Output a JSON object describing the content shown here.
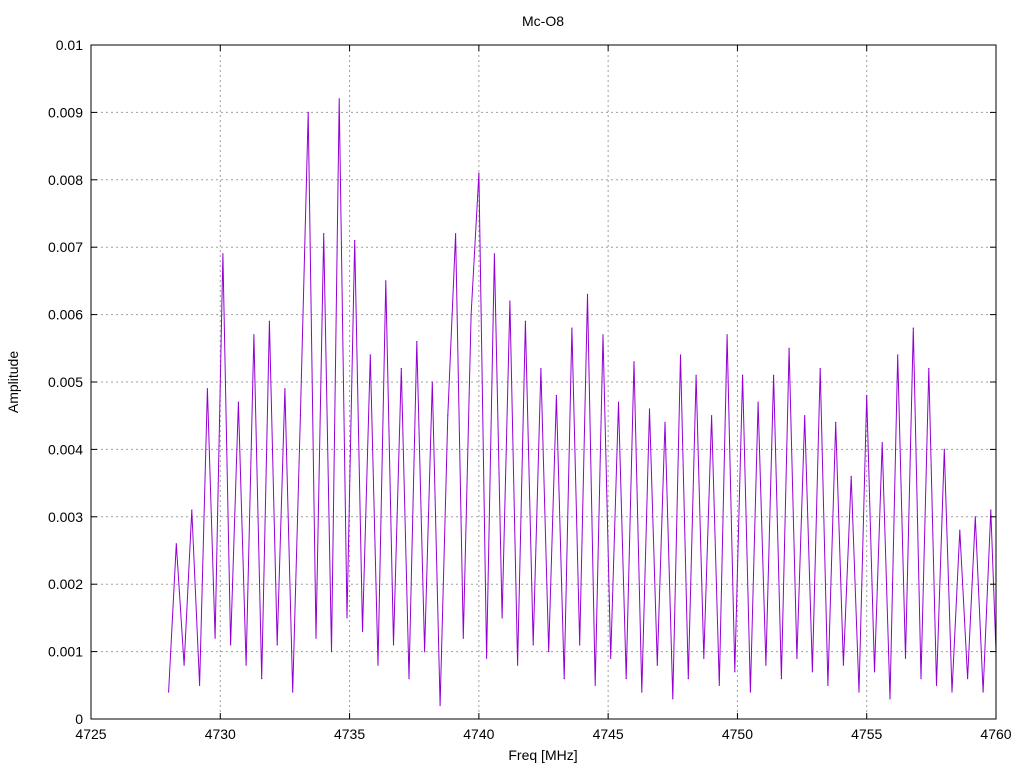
{
  "chart_data": {
    "type": "line",
    "title": "Mc-O8",
    "xlabel": "Freq [MHz]",
    "ylabel": "Amplitude",
    "xlim": [
      4725,
      4760
    ],
    "ylim": [
      0,
      0.01
    ],
    "x_ticks": [
      "4725",
      "4730",
      "4735",
      "4740",
      "4745",
      "4750",
      "4755",
      "4760"
    ],
    "y_ticks": [
      "0",
      "0.001",
      "0.002",
      "0.003",
      "0.004",
      "0.005",
      "0.006",
      "0.007",
      "0.008",
      "0.009",
      "0.01"
    ],
    "grid": true,
    "legend": "none",
    "series": [
      {
        "color": "#9400d3",
        "x": [
          4728.0,
          4728.3,
          4728.6,
          4728.9,
          4729.2,
          4729.5,
          4729.8,
          4730.1,
          4730.4,
          4730.7,
          4731.0,
          4731.3,
          4731.6,
          4731.9,
          4732.2,
          4732.5,
          4732.8,
          4733.1,
          4733.4,
          4733.7,
          4734.0,
          4734.3,
          4734.6,
          4734.9,
          4735.2,
          4735.5,
          4735.8,
          4736.1,
          4736.4,
          4736.7,
          4737.0,
          4737.3,
          4737.6,
          4737.9,
          4738.2,
          4738.5,
          4738.8,
          4739.1,
          4739.4,
          4739.7,
          4740.0,
          4740.3,
          4740.6,
          4740.9,
          4741.2,
          4741.5,
          4741.8,
          4742.1,
          4742.4,
          4742.7,
          4743.0,
          4743.3,
          4743.6,
          4743.9,
          4744.2,
          4744.5,
          4744.8,
          4745.1,
          4745.4,
          4745.7,
          4746.0,
          4746.3,
          4746.6,
          4746.9,
          4747.2,
          4747.5,
          4747.8,
          4748.1,
          4748.4,
          4748.7,
          4749.0,
          4749.3,
          4749.6,
          4749.9,
          4750.2,
          4750.5,
          4750.8,
          4751.1,
          4751.4,
          4751.7,
          4752.0,
          4752.3,
          4752.6,
          4752.9,
          4753.2,
          4753.5,
          4753.8,
          4754.1,
          4754.4,
          4754.7,
          4755.0,
          4755.3,
          4755.6,
          4755.9,
          4756.2,
          4756.5,
          4756.8,
          4757.1,
          4757.4,
          4757.7,
          4758.0,
          4758.3,
          4758.6,
          4758.9,
          4759.2,
          4759.5,
          4759.8,
          4760.0
        ],
        "y": [
          0.0004,
          0.0026,
          0.0008,
          0.0031,
          0.0005,
          0.0049,
          0.0012,
          0.0069,
          0.0011,
          0.0047,
          0.0008,
          0.0057,
          0.0006,
          0.0059,
          0.0011,
          0.0049,
          0.0004,
          0.0045,
          0.009,
          0.0012,
          0.0072,
          0.001,
          0.0092,
          0.0015,
          0.0071,
          0.0013,
          0.0054,
          0.0008,
          0.0065,
          0.0011,
          0.0052,
          0.0006,
          0.0056,
          0.001,
          0.005,
          0.0002,
          0.0045,
          0.0072,
          0.0012,
          0.006,
          0.0081,
          0.0009,
          0.0069,
          0.0015,
          0.0062,
          0.0008,
          0.0059,
          0.0011,
          0.0052,
          0.001,
          0.0048,
          0.0006,
          0.0058,
          0.0011,
          0.0063,
          0.0005,
          0.0057,
          0.0009,
          0.0047,
          0.0006,
          0.0053,
          0.0004,
          0.0046,
          0.0008,
          0.0044,
          0.0003,
          0.0054,
          0.0006,
          0.0051,
          0.0009,
          0.0045,
          0.0005,
          0.0057,
          0.0007,
          0.0051,
          0.0004,
          0.0047,
          0.0008,
          0.0051,
          0.0006,
          0.0055,
          0.0009,
          0.0045,
          0.0007,
          0.0052,
          0.0005,
          0.0044,
          0.0008,
          0.0036,
          0.0004,
          0.0048,
          0.0007,
          0.0041,
          0.0003,
          0.0054,
          0.0009,
          0.0058,
          0.0006,
          0.0052,
          0.0005,
          0.004,
          0.0004,
          0.0028,
          0.0006,
          0.003,
          0.0004,
          0.0031,
          0.001
        ]
      }
    ]
  }
}
